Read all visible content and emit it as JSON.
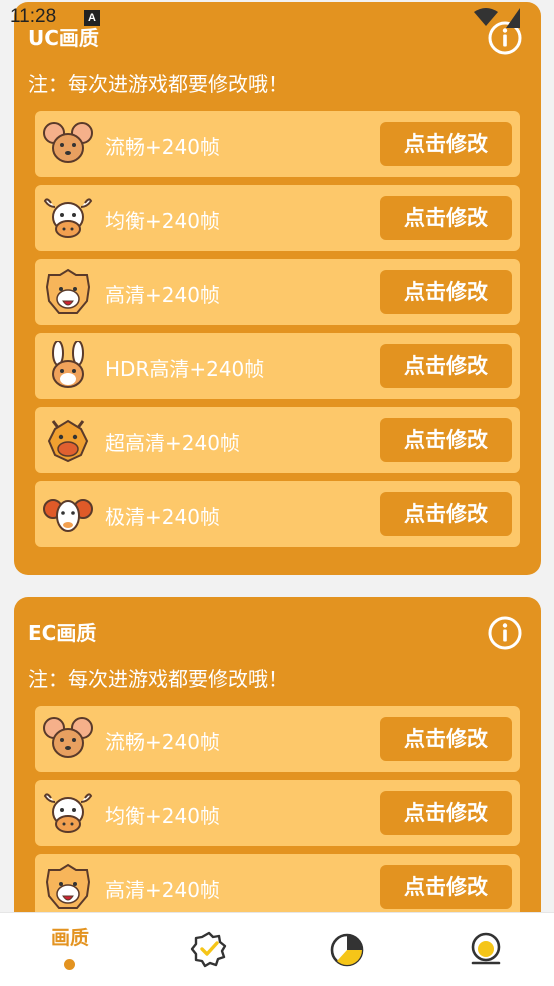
{
  "status_bar": {
    "time": "11:28",
    "notification_letter": "A"
  },
  "colors": {
    "accent": "#e39320",
    "row_bg": "#fdc86a",
    "text_on_accent": "#ffffff"
  },
  "cards": [
    {
      "title": "UC画质",
      "note": "注：每次进游戏都要修改哦！",
      "rows": [
        {
          "icon": "rat-icon",
          "label": "流畅+240帧",
          "button": "点击修改"
        },
        {
          "icon": "ox-icon",
          "label": "均衡+240帧",
          "button": "点击修改"
        },
        {
          "icon": "tiger-icon",
          "label": "高清+240帧",
          "button": "点击修改"
        },
        {
          "icon": "rabbit-icon",
          "label": "HDR高清+240帧",
          "button": "点击修改"
        },
        {
          "icon": "dragon-icon",
          "label": "超高清+240帧",
          "button": "点击修改"
        },
        {
          "icon": "ram-icon",
          "label": "极清+240帧",
          "button": "点击修改"
        }
      ]
    },
    {
      "title": "EC画质",
      "note": "注：每次进游戏都要修改哦！",
      "rows": [
        {
          "icon": "rat-icon",
          "label": "流畅+240帧",
          "button": "点击修改"
        },
        {
          "icon": "ox-icon",
          "label": "均衡+240帧",
          "button": "点击修改"
        },
        {
          "icon": "tiger-icon",
          "label": "高清+240帧",
          "button": "点击修改"
        }
      ]
    }
  ],
  "bottom_nav": {
    "items": [
      {
        "label": "画质",
        "icon": "quality-icon",
        "active": true
      },
      {
        "label": "",
        "icon": "badge-check-icon",
        "active": false
      },
      {
        "label": "",
        "icon": "pie-chart-icon",
        "active": false
      },
      {
        "label": "",
        "icon": "profile-icon",
        "active": false
      }
    ]
  }
}
